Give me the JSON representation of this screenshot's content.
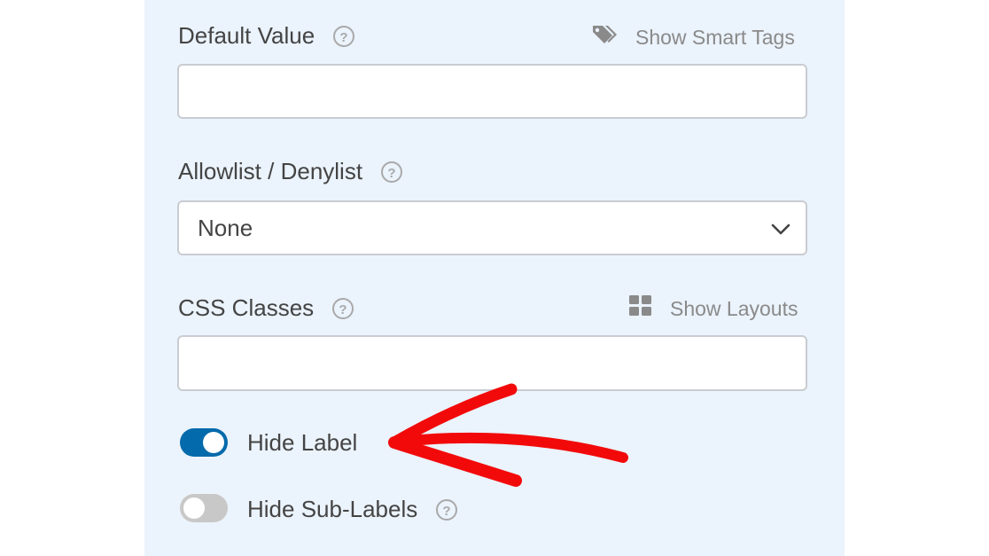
{
  "default_value": {
    "label": "Default Value",
    "help_icon": "question-circle-icon",
    "smart_tags_link": "Show Smart Tags",
    "smart_tags_icon": "tags-icon",
    "value": "",
    "placeholder": ""
  },
  "allowlist": {
    "label": "Allowlist / Denylist",
    "help_icon": "question-circle-icon",
    "selected": "None",
    "dropdown_icon": "chevron-down-icon"
  },
  "css_classes": {
    "label": "CSS Classes",
    "help_icon": "question-circle-icon",
    "layouts_link": "Show Layouts",
    "layouts_icon": "grid-icon",
    "value": "",
    "placeholder": ""
  },
  "toggles": [
    {
      "label": "Hide Label",
      "state": "on"
    },
    {
      "label": "Hide Sub-Labels",
      "state": "off",
      "help_icon": "question-circle-icon"
    }
  ],
  "annotation": {
    "icon": "red-arrow-annotation",
    "color": "#f20a0a"
  },
  "colors": {
    "panel_background": "#ebf3fc",
    "toggle_on": "#036aab",
    "toggle_off": "#c8c8c8",
    "text": "#444444",
    "muted_text": "#8a8a8a"
  }
}
